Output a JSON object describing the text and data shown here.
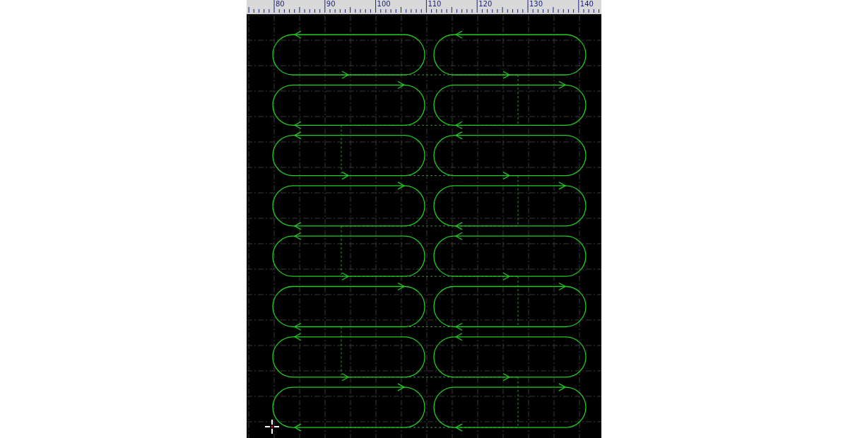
{
  "ruler": {
    "labels": [
      "80",
      "90",
      "100",
      "110",
      "120",
      "130",
      "140"
    ]
  }
}
